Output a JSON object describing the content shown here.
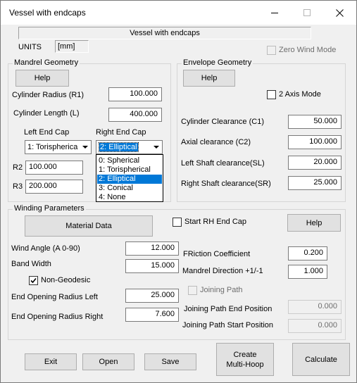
{
  "window": {
    "title": "Vessel with endcaps",
    "header_label": "Vessel with endcaps",
    "units_label": "UNITS",
    "units_value": "[mm]",
    "zero_wind_mode_label": "Zero Wind Mode"
  },
  "mandrel": {
    "group_title": "Mandrel Geometry",
    "help_label": "Help",
    "cyl_radius_label": "Cylinder Radius (R1)",
    "cyl_radius_value": "100.000",
    "cyl_length_label": "Cylinder Length (L)",
    "cyl_length_value": "400.000",
    "left_cap_label": "Left End Cap",
    "left_cap_value": "1: Torispherica",
    "right_cap_label": "Right End Cap",
    "right_cap_value": "2: Elliptical",
    "right_cap_options": [
      "0: Spherical",
      "1: Torispherical",
      "2: Elliptical",
      "3: Conical",
      "4: None"
    ],
    "right_cap_selected_index": 2,
    "r2_label": "R2",
    "r2_value": "100.000",
    "r3_label": "R3",
    "r3_value": "200.000"
  },
  "envelope": {
    "group_title": "Envelope Geometry",
    "help_label": "Help",
    "two_axis_label": "2 Axis Mode",
    "c1_label": "Cylinder Clearance (C1)",
    "c1_value": "50.000",
    "c2_label": "Axial clearance (C2)",
    "c2_value": "100.000",
    "sl_label": "Left Shaft clearance(SL)",
    "sl_value": "20.000",
    "sr_label": "Right Shaft clearance(SR)",
    "sr_value": "25.000"
  },
  "winding": {
    "group_title": "Winding Parameters",
    "material_label": "Material Data",
    "start_rh_label": "Start RH End Cap",
    "help_label": "Help",
    "wind_angle_label": "Wind Angle (A 0-90)",
    "wind_angle_value": "12.000",
    "band_width_label": "Band Width",
    "band_width_value": "15.000",
    "non_geodesic_label": "Non-Geodesic",
    "end_open_left_label": "End Opening Radius Left",
    "end_open_left_value": "25.000",
    "end_open_right_label": "End Opening Radius Right",
    "end_open_right_value": "7.600",
    "friction_label": "FRiction Coefficient",
    "friction_value": "0.200",
    "mandrel_dir_label": "Mandrel Direction +1/-1",
    "mandrel_dir_value": "1.000",
    "joining_path_label": "Joining Path",
    "jp_end_label": "Joining Path End Position",
    "jp_end_value": "0.000",
    "jp_start_label": "Joining Path Start Position",
    "jp_start_value": "0.000"
  },
  "footer": {
    "exit_label": "Exit",
    "open_label": "Open",
    "save_label": "Save",
    "multi_hoop_line1": "Create",
    "multi_hoop_line2": "Multi-Hoop",
    "calculate_label": "Calculate"
  },
  "icons": {
    "minimize": "minimize-icon",
    "maximize": "maximize-icon",
    "close": "close-icon",
    "checkmark": "checkmark-icon",
    "dropdown": "chevron-down-icon"
  },
  "colors": {
    "selection": "#0078d7",
    "window_bg": "#f0f0f0",
    "titlebar_bg": "#ffffff"
  }
}
